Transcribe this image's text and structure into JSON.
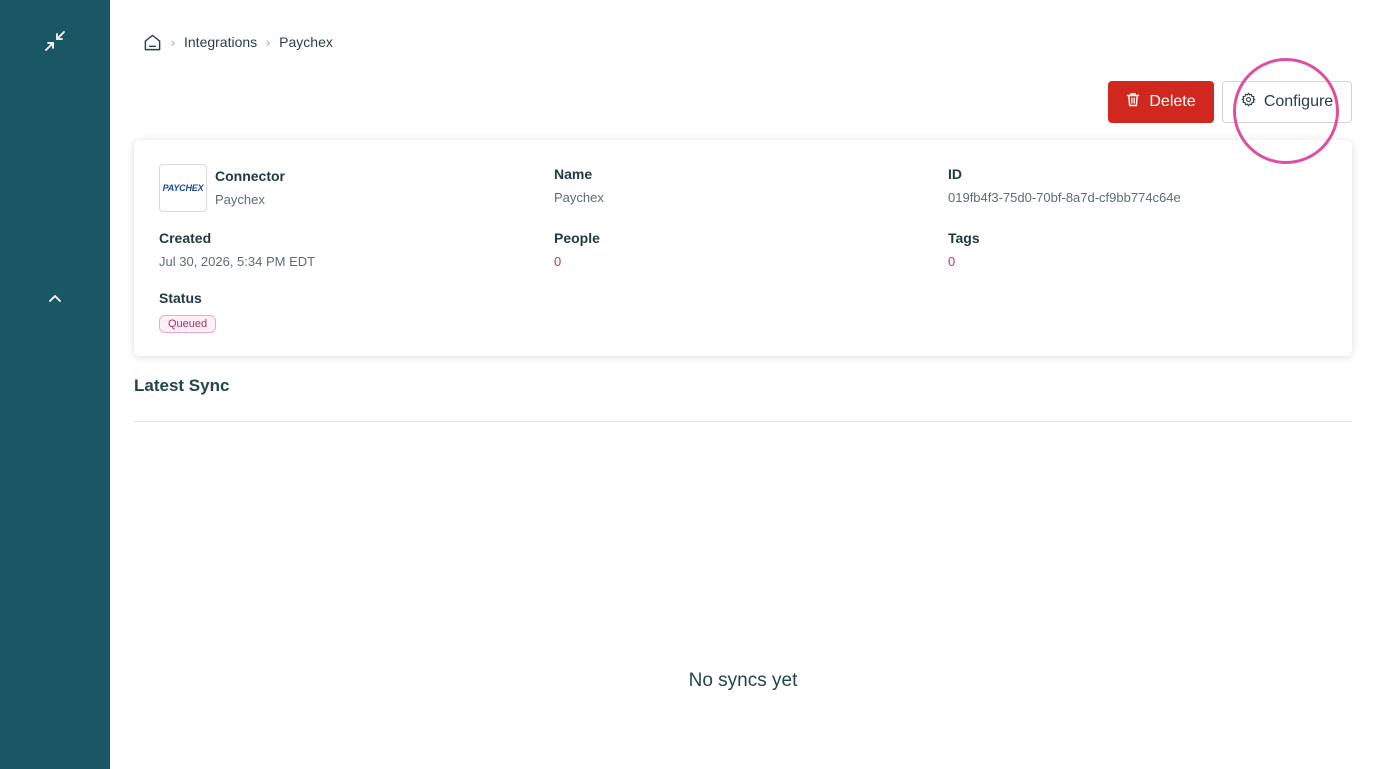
{
  "sidebar": {
    "collapse_icon": "collapse-arrows-icon",
    "chevron_icon": "chevron-up-icon",
    "background": "#1a5765"
  },
  "breadcrumb": {
    "home_icon": "home-icon",
    "items": [
      "Integrations",
      "Paychex"
    ]
  },
  "actions": {
    "delete_label": "Delete",
    "configure_label": "Configure",
    "delete_color": "#d0281e"
  },
  "connector": {
    "logo_text": "PAYCHEX",
    "connector_label": "Connector",
    "connector_value": "Paychex",
    "name_label": "Name",
    "name_value": "Paychex",
    "id_label": "ID",
    "id_value": "019fb4f3-75d0-70bf-8a7d-cf9bb774c64e",
    "created_label": "Created",
    "created_value": "Jul 30, 2026, 5:34 PM EDT",
    "people_label": "People",
    "people_value": "0",
    "tags_label": "Tags",
    "tags_value": "0",
    "status_label": "Status",
    "status_value": "Queued"
  },
  "latest_sync": {
    "title": "Latest Sync",
    "empty_text": "No syncs yet"
  }
}
